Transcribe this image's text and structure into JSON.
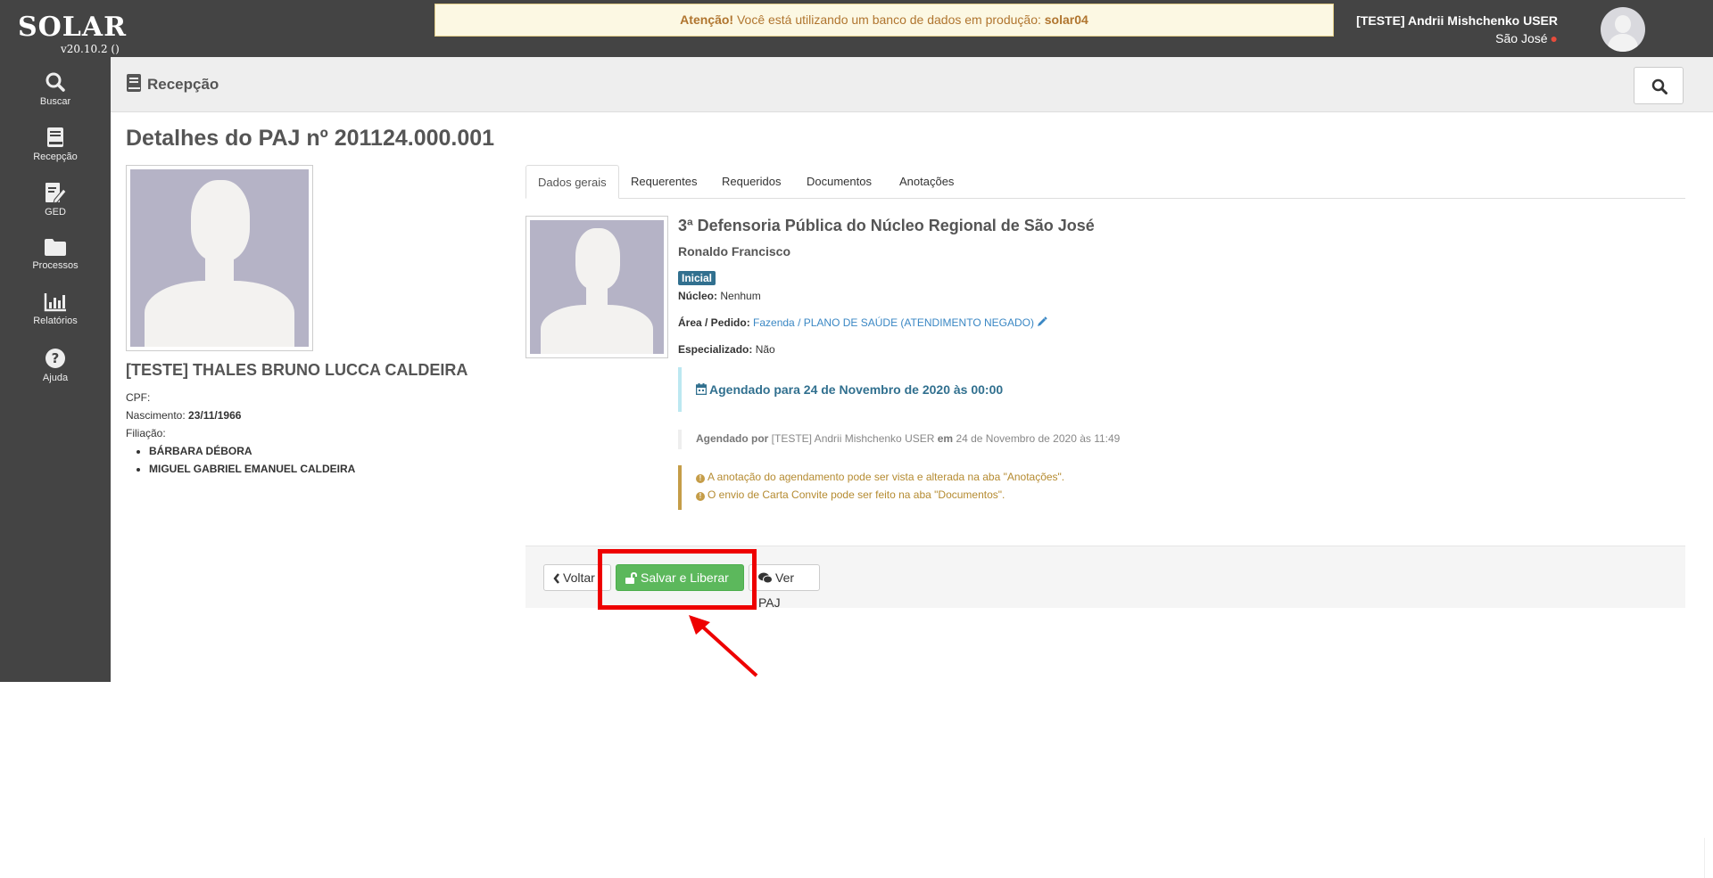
{
  "app": {
    "logo": "SOLAR",
    "version": "v20.10.2 ()"
  },
  "alert": {
    "prefix": "Atenção!",
    "message": "Você está utilizando um banco de dados em produção:",
    "database": "solar04"
  },
  "user": {
    "name": "[TESTE] Andrii Mishchenko USER",
    "location": "São José"
  },
  "sidebar": {
    "items": [
      {
        "label": "Buscar",
        "icon": "search-icon"
      },
      {
        "label": "Recepção",
        "icon": "book-icon"
      },
      {
        "label": "GED",
        "icon": "edit-document-icon"
      },
      {
        "label": "Processos",
        "icon": "folder-icon"
      },
      {
        "label": "Relatórios",
        "icon": "bar-chart-icon"
      },
      {
        "label": "Ajuda",
        "icon": "question-icon"
      }
    ]
  },
  "header": {
    "title": "Recepção"
  },
  "page": {
    "title": "Detalhes do PAJ nº 201124.000.001"
  },
  "person": {
    "name": "[TESTE] THALES BRUNO LUCCA CALDEIRA",
    "cpf_label": "CPF:",
    "birth_label": "Nascimento:",
    "birth_value": "23/11/1966",
    "filiation_label": "Filiação:",
    "parents": [
      "BÁRBARA DÉBORA",
      "MIGUEL GABRIEL EMANUEL CALDEIRA"
    ]
  },
  "tabs": [
    "Dados gerais",
    "Requerentes",
    "Requeridos",
    "Documentos",
    "Anotações"
  ],
  "details": {
    "office": "3ª Defensoria Pública do Núcleo Regional de São José",
    "defender": "Ronaldo Francisco",
    "badge": "Inicial",
    "nucleo_label": "Núcleo:",
    "nucleo_value": "Nenhum",
    "area_label": "Área / Pedido:",
    "area_value": "Fazenda / PLANO DE SAÚDE (ATENDIMENTO NEGADO)",
    "specialized_label": "Especializado:",
    "specialized_value": "Não",
    "scheduled": "Agendado para 24 de Novembro de 2020 às 00:00",
    "scheduled_by_label": "Agendado por",
    "scheduled_by_value": "[TESTE] Andrii Mishchenko USER",
    "scheduled_on_label": "em",
    "scheduled_on_value": "24 de Novembro de 2020 às 11:49",
    "note1": "A anotação do agendamento pode ser vista e alterada na aba \"Anotações\".",
    "note2": "O envio de Carta Convite pode ser feito na aba \"Documentos\"."
  },
  "actions": {
    "back": "Voltar",
    "save": "Salvar e Liberar",
    "view": "Ver PAJ"
  },
  "colors": {
    "sidebar": "#444444",
    "save_button": "#5cb85c",
    "highlight": "#ee0000",
    "badge": "#31708f"
  }
}
